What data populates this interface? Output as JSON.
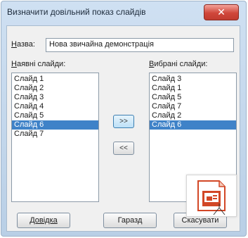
{
  "dialog": {
    "title": "Визначити довільний показ слайдів",
    "close_label": "✕"
  },
  "name_field": {
    "label_prefix": "",
    "label_accel": "Н",
    "label_rest": "азва:",
    "value": "Нова звичайна демонстрація"
  },
  "available": {
    "label_accel": "Н",
    "label_rest": "аявні слайди:",
    "items": [
      "Слайд 1",
      "Слайд 2",
      "Слайд 3",
      "Слайд 4",
      "Слайд 5",
      "Слайд 6",
      "Слайд 7"
    ],
    "selected_index": 5
  },
  "chosen": {
    "label_accel": "В",
    "label_rest": "ибрані слайди:",
    "items": [
      "Слайд 3",
      "Слайд 1",
      "Слайд 5",
      "Слайд 7",
      "Слайд 2",
      "Слайд 6"
    ],
    "selected_index": 5
  },
  "buttons": {
    "add": ">>",
    "remove": "<<",
    "help": "Довідка",
    "ok": "Гаразд",
    "cancel": "Скасувати"
  },
  "colors": {
    "selection": "#3f82c8",
    "icon_orange": "#d24726"
  },
  "app_icon": "presentation-app-icon"
}
